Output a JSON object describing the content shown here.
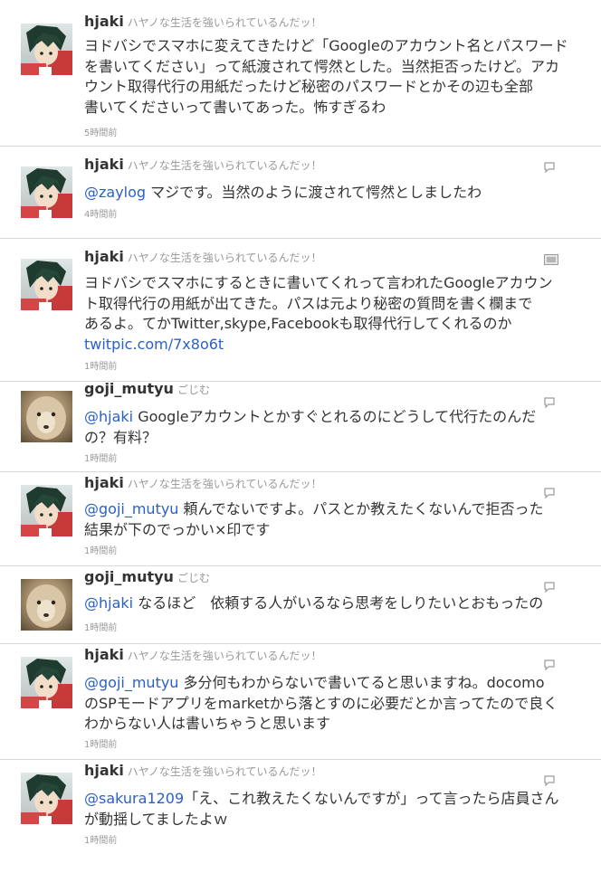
{
  "tweets": [
    {
      "screen_name": "hjaki",
      "full_name": "ハヤノな生活を強いられているんだッ！",
      "lines": [
        {
          "text": "ヨドバシでスマホに変えてきたけど「Googleのアカウント名とパスワード"
        },
        {
          "text": "を書いてください」って紙渡されて愕然とした。当然拒否ったけど。アカ"
        },
        {
          "text": "ウント取得代行の用紙だったけど秘密のパスワードとかその辺も全部"
        },
        {
          "text": "書いてくださいって書いてあった。怖すぎるわ"
        }
      ],
      "time": "5時間前",
      "avatar": "anime-character-avatar",
      "action_icon": "none"
    },
    {
      "screen_name": "hjaki",
      "full_name": "ハヤノな生活を強いられているんだッ！",
      "lines": [
        {
          "mention": "@zaylog",
          "text": " マジです。当然のように渡されて愕然としましたわ"
        }
      ],
      "time": "4時間前",
      "avatar": "anime-character-avatar",
      "action_icon": "reply-bubble-icon"
    },
    {
      "screen_name": "hjaki",
      "full_name": "ハヤノな生活を強いられているんだッ！",
      "lines": [
        {
          "text": "ヨドバシでスマホにするときに書いてくれって言われたGoogleアカウン"
        },
        {
          "text": "ト取得代行の用紙が出てきた。パスは元より秘密の質問を書く欄まで"
        },
        {
          "text": "あるよ。てかTwitter,skype,Facebookも取得代行してくれるのか"
        }
      ],
      "link": "twitpic.com/7x8o6t",
      "time": "1時間前",
      "avatar": "anime-character-avatar",
      "action_icon": "photo-icon"
    },
    {
      "screen_name": "goji_mutyu",
      "full_name": "ごじむ",
      "lines": [
        {
          "mention": "@hjaki",
          "text": " Googleアカウントとかすぐとれるのにどうして代行たのんだ"
        },
        {
          "text": "の？有料？"
        }
      ],
      "time": "1時間前",
      "avatar": "sheep-avatar",
      "action_icon": "reply-bubble-icon"
    },
    {
      "screen_name": "hjaki",
      "full_name": "ハヤノな生活を強いられているんだッ！",
      "lines": [
        {
          "mention": "@goji_mutyu",
          "text": " 頼んでないですよ。パスとか教えたくないんで拒否った"
        },
        {
          "text": "結果が下のでっかい×印です"
        }
      ],
      "time": "1時間前",
      "avatar": "anime-character-avatar",
      "action_icon": "reply-bubble-icon"
    },
    {
      "screen_name": "goji_mutyu",
      "full_name": "ごじむ",
      "lines": [
        {
          "mention": "@hjaki",
          "text": " なるほど　依頼する人がいるなら思考をしりたいとおもったの"
        }
      ],
      "time": "1時間前",
      "avatar": "sheep-avatar",
      "action_icon": "reply-bubble-icon"
    },
    {
      "screen_name": "hjaki",
      "full_name": "ハヤノな生活を強いられているんだッ！",
      "lines": [
        {
          "mention": "@goji_mutyu",
          "text": " 多分何もわからないで書いてると思いますね。docomo"
        },
        {
          "text": "のSPモードアプリをmarketから落とすのに必要だとか言ってたので良く"
        },
        {
          "text": "わからない人は書いちゃうと思います"
        }
      ],
      "time": "1時間前",
      "avatar": "anime-character-avatar",
      "action_icon": "reply-bubble-icon"
    },
    {
      "screen_name": "hjaki",
      "full_name": "ハヤノな生活を強いられているんだッ！",
      "lines": [
        {
          "mention": "@sakura1209",
          "text": "「え、これ教えたくないんですが」って言ったら店員さん"
        },
        {
          "text": "が動揺してましたよｗ"
        }
      ],
      "time": "1時間前",
      "avatar": "anime-character-avatar",
      "action_icon": "reply-bubble-icon"
    }
  ],
  "colors": {
    "link": "#2b61c4",
    "text": "#333333",
    "meta": "#999999",
    "divider": "#d8d8d8"
  }
}
